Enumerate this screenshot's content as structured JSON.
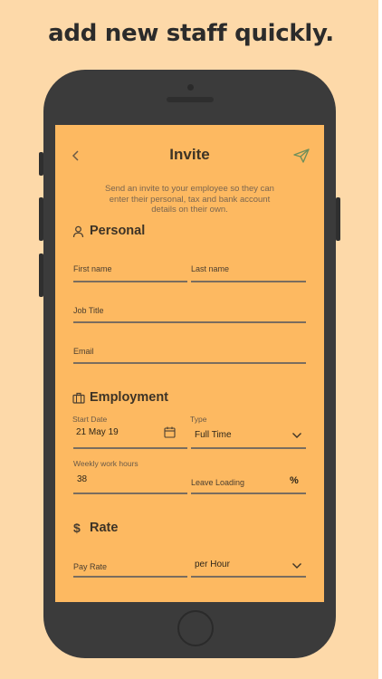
{
  "headline": "add new staff quickly.",
  "header": {
    "title": "Invite",
    "back_icon": "chevron-left-icon",
    "send_icon": "paper-plane-icon"
  },
  "intro": {
    "line1": "Send an invite to your employee so they can",
    "line2": "enter their personal, tax and bank account",
    "line3": "details on their own."
  },
  "personal": {
    "title": "Personal",
    "icon": "person-icon",
    "first_name_placeholder": "First name",
    "last_name_placeholder": "Last name",
    "job_title_placeholder": "Job Title",
    "email_placeholder": "Email"
  },
  "employment": {
    "title": "Employment",
    "icon": "briefcase-icon",
    "start_date_label": "Start Date",
    "start_date_value": "21 May 19",
    "type_label": "Type",
    "type_value": "Full Time",
    "hours_label": "Weekly work hours",
    "hours_value": "38",
    "leave_loading_placeholder": "Leave Loading",
    "percent_symbol": "%"
  },
  "rate": {
    "title": "Rate",
    "icon": "dollar-icon",
    "pay_rate_placeholder": "Pay Rate",
    "period_value": "per Hour"
  },
  "colors": {
    "background": "#fdd9a9",
    "screen": "#fdb961",
    "phone": "#3b3b3b",
    "accent_icon": "#6f8f5a"
  }
}
